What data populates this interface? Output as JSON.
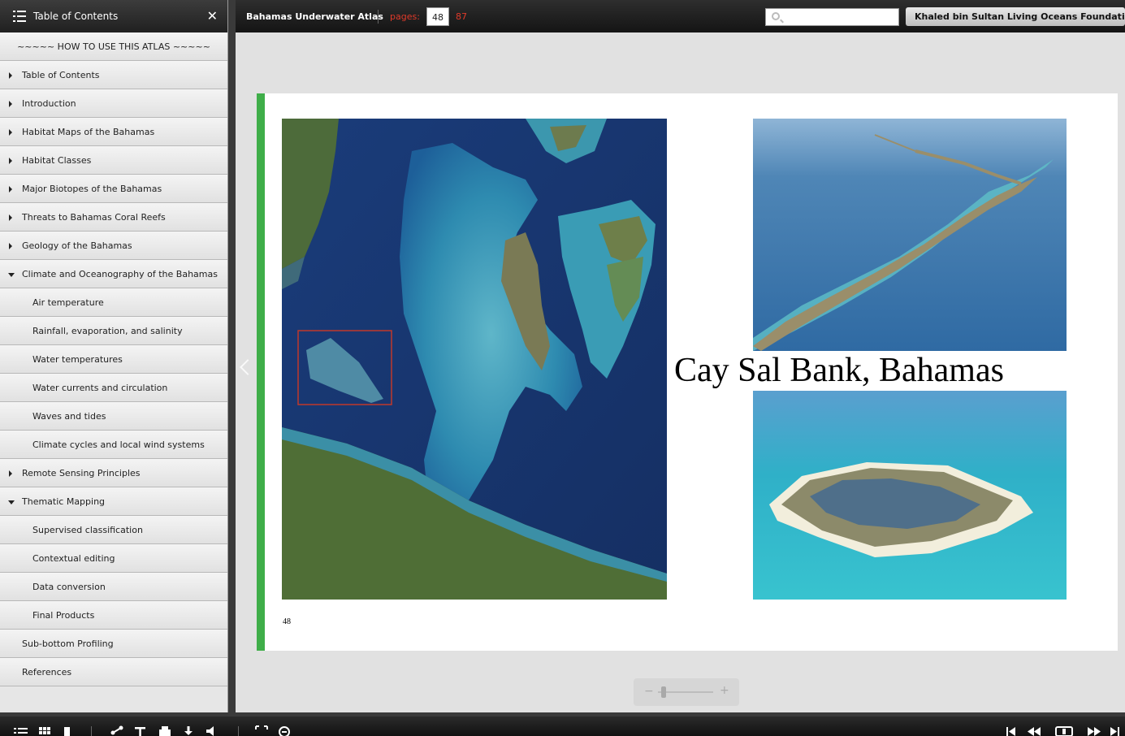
{
  "sidebar": {
    "title": "Table of Contents",
    "close_symbol": "✕",
    "items": [
      {
        "label": "~~~~~  HOW TO USE THIS ATLAS  ~~~~~",
        "level": 0,
        "arrow": "none"
      },
      {
        "label": "Table of Contents",
        "level": 0,
        "arrow": "right"
      },
      {
        "label": "Introduction",
        "level": 0,
        "arrow": "right"
      },
      {
        "label": "Habitat Maps of the Bahamas",
        "level": 0,
        "arrow": "right"
      },
      {
        "label": "Habitat Classes",
        "level": 0,
        "arrow": "right"
      },
      {
        "label": "Major Biotopes of the Bahamas",
        "level": 0,
        "arrow": "right"
      },
      {
        "label": "Threats to Bahamas Coral Reefs",
        "level": 0,
        "arrow": "right"
      },
      {
        "label": "Geology of the Bahamas",
        "level": 0,
        "arrow": "right"
      },
      {
        "label": "Climate and Oceanography of the Bahamas",
        "level": 0,
        "arrow": "down"
      },
      {
        "label": "Air temperature",
        "level": 1,
        "arrow": "none"
      },
      {
        "label": "Rainfall, evaporation, and salinity",
        "level": 1,
        "arrow": "none"
      },
      {
        "label": "Water temperatures",
        "level": 1,
        "arrow": "none"
      },
      {
        "label": "Water currents and circulation",
        "level": 1,
        "arrow": "none"
      },
      {
        "label": "Waves and tides",
        "level": 1,
        "arrow": "none"
      },
      {
        "label": "Climate cycles and local wind systems",
        "level": 1,
        "arrow": "none"
      },
      {
        "label": "Remote Sensing Principles",
        "level": 0,
        "arrow": "right"
      },
      {
        "label": "Thematic Mapping",
        "level": 0,
        "arrow": "down"
      },
      {
        "label": "Supervised classification",
        "level": 1,
        "arrow": "none"
      },
      {
        "label": "Contextual editing",
        "level": 1,
        "arrow": "none"
      },
      {
        "label": "Data conversion",
        "level": 1,
        "arrow": "none"
      },
      {
        "label": "Final Products",
        "level": 1,
        "arrow": "none"
      },
      {
        "label": "Sub-bottom Profiling",
        "level": 0,
        "arrow": "none"
      },
      {
        "label": "References",
        "level": 0,
        "arrow": "none"
      }
    ]
  },
  "topbar": {
    "book_title": "Bahamas Underwater Atlas",
    "pages_label": "pages:",
    "current_page": "48",
    "total_pages": "87",
    "search_placeholder": "",
    "foundation_button": "Khaled bin Sultan Living Oceans Foundation"
  },
  "page": {
    "caption": "Cay Sal Bank, Bahamas",
    "number": "48"
  },
  "zoom": {
    "minus": "−",
    "plus": "+",
    "level": 0.05
  },
  "colors": {
    "accent_red": "#e03a2a",
    "page_edge_green": "#3fae49"
  },
  "icons": {
    "bottombar": [
      "toc-icon",
      "thumbnails-icon",
      "bookmark-icon",
      "share-icon",
      "text-icon",
      "print-icon",
      "download-icon",
      "sound-icon",
      "fullscreen-icon",
      "zoom-out-icon",
      "first-page-icon",
      "previous-page-icon",
      "two-page-view-icon",
      "next-page-icon",
      "last-page-icon"
    ]
  }
}
